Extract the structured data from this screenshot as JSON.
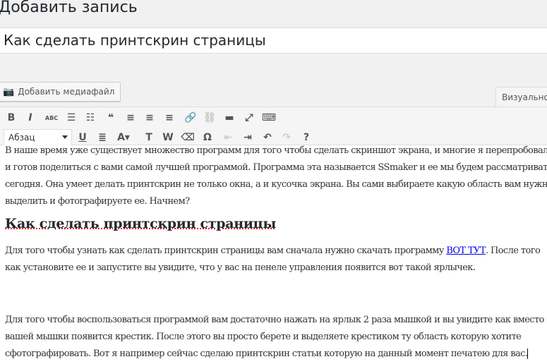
{
  "header": {
    "title": "Добавить запись"
  },
  "post_title": {
    "value": "Как сделать принтскрин страницы"
  },
  "media_button": {
    "label": "Добавить медиафайл"
  },
  "tabs": {
    "visual": "Визуально"
  },
  "toolbar": {
    "format_select": "Абзац",
    "row1": [
      {
        "icon": "bold-icon",
        "glyph": "B"
      },
      {
        "icon": "italic-icon",
        "glyph": "I"
      },
      {
        "icon": "strikethrough-icon",
        "glyph": "ABC"
      },
      {
        "icon": "bullet-list-icon",
        "glyph": "☰"
      },
      {
        "icon": "numbered-list-icon",
        "glyph": "☷"
      },
      {
        "icon": "blockquote-icon",
        "glyph": "❝"
      },
      {
        "icon": "align-left-icon",
        "glyph": "≡"
      },
      {
        "icon": "align-center-icon",
        "glyph": "≡"
      },
      {
        "icon": "align-right-icon",
        "glyph": "≡"
      },
      {
        "icon": "link-icon",
        "glyph": "🔗"
      },
      {
        "icon": "unlink-icon",
        "glyph": "⛓"
      },
      {
        "icon": "read-more-icon",
        "glyph": "▬"
      },
      {
        "icon": "fullscreen-icon",
        "glyph": "⤢"
      },
      {
        "icon": "toolbar-toggle-icon",
        "glyph": "⌨"
      }
    ],
    "row2": [
      {
        "icon": "underline-icon",
        "glyph": "U"
      },
      {
        "icon": "justify-icon",
        "glyph": "≣"
      },
      {
        "icon": "text-color-icon",
        "glyph": "A▾"
      },
      {
        "icon": "paste-text-icon",
        "glyph": "T"
      },
      {
        "icon": "paste-word-icon",
        "glyph": "W"
      },
      {
        "icon": "clear-formatting-icon",
        "glyph": "⌫"
      },
      {
        "icon": "special-character-icon",
        "glyph": "Ω"
      },
      {
        "icon": "outdent-icon",
        "glyph": "⇤"
      },
      {
        "icon": "indent-icon",
        "glyph": "⇥"
      },
      {
        "icon": "undo-icon",
        "glyph": "↶"
      },
      {
        "icon": "redo-icon",
        "glyph": "↷"
      },
      {
        "icon": "help-icon",
        "glyph": "?"
      }
    ]
  },
  "content": {
    "p1": [
      "В наше время уже существует множество программ для того чтобы сделать скриншот экрана, и многие я перепробовал",
      "и готов поделиться с вами самой лучшей программой. Программа эта называется SSmaker и ее мы будем рассматривать",
      "сегодня. Она умеет делать принтскрин не только окна, а и кусочка экрана. Вы сами выбираете какую область вам нужно",
      "выделить и фотографируете ее. Начнем?"
    ],
    "heading": "Как сделать принтскрин страницы",
    "p2a": "Для того чтобы узнать как сделать принтскрин страницы вам сначала нужно скачать программу ",
    "p2_link": "ВОТ ТУТ",
    "p2b": ". После того",
    "p2c": "как установите ее и запустите вы увидите, что у вас на пенеле управления появится вот такой ярлычек.",
    "p3": [
      "Для того чтобы воспользоваться программой вам достаточно нажать на ярлык 2 раза мышкой и вы увидите как вместо",
      "вашей мышки появится крестик. После этого вы просто берете и выделяете крестиком ту область которую хотите",
      "сфотографировать. Вот я например сейчас сделаю принтскрин статьи которую на данный момент печатею для вас."
    ]
  }
}
